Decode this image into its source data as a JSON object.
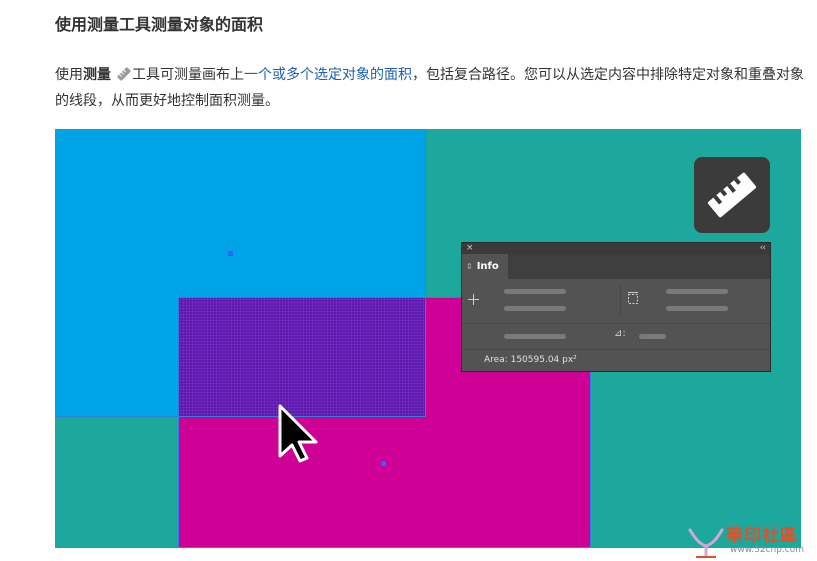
{
  "heading": "使用测量工具测量对象的面积",
  "paragraph": {
    "prefix": "使用",
    "tool_name": "测量",
    "after_tool": "工具可测量画布上",
    "link_text": "一个或多个选定对象的面积",
    "suffix": "，包括复合路径。您可以从选定内容中排除特定对象和重叠对象的线段，从而更好地控制面积测量。"
  },
  "colors": {
    "canvas_bg": "#1ca89c",
    "blue_object": "#00a3e6",
    "magenta_object": "#cf0095",
    "overlap": "#5a1aa6",
    "selection_outline": "#2f7fe0",
    "panel_bg": "#535353",
    "link": "#1a5fb4"
  },
  "icons": {
    "inline_tool": "ruler-icon",
    "tool_badge": "ruler-icon",
    "cursor": "arrow-cursor-icon",
    "panel_close": "close-icon",
    "panel_collapse": "double-chevron-icon",
    "crosshair": "crosshair-icon",
    "bounds": "dimensions-icon",
    "angle": "angle-icon"
  },
  "info_panel": {
    "close_glyph": "×",
    "collapse_glyph": "‹‹",
    "tab_grip": "⇕",
    "tab_label": "Info",
    "area_label": "Area: 150595.04 px²",
    "angle_glyph": "⊿:"
  },
  "watermark": {
    "name": "華印社區",
    "url": "www.52cnp.com"
  }
}
